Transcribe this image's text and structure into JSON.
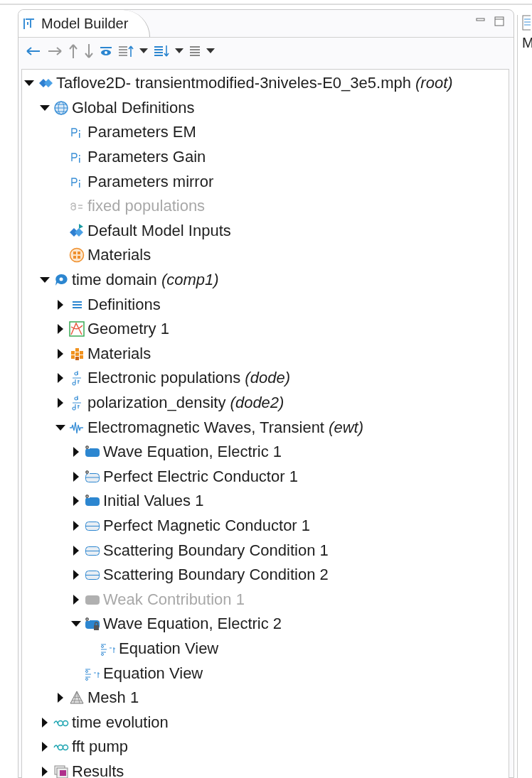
{
  "panel": {
    "title": "Model Builder",
    "side_text": "M"
  },
  "tree": [
    {
      "label": "Taflove2D- transientmodified-3niveles-E0_3e5.mph *(root)*",
      "kind": "model",
      "disabled": false,
      "expanded": true,
      "children": [
        {
          "label": "Global Definitions",
          "kind": "globe",
          "disabled": false,
          "expanded": true,
          "children": [
            {
              "label": "Parameters EM",
              "kind": "parameters",
              "disabled": false
            },
            {
              "label": "Parameters Gain",
              "kind": "parameters",
              "disabled": false
            },
            {
              "label": "Parameters mirror",
              "kind": "parameters",
              "disabled": false
            },
            {
              "label": "fixed populations",
              "kind": "variables",
              "disabled": true
            },
            {
              "label": "Default Model Inputs",
              "kind": "inputs",
              "disabled": false
            },
            {
              "label": "Materials",
              "kind": "materials-round",
              "disabled": false
            }
          ]
        },
        {
          "label": "time domain *(comp1)*",
          "kind": "component",
          "disabled": false,
          "expanded": true,
          "children": [
            {
              "label": "Definitions",
              "kind": "definitions",
              "disabled": false,
              "expanded": false
            },
            {
              "label": "Geometry 1",
              "kind": "geometry",
              "disabled": false,
              "expanded": false
            },
            {
              "label": "Materials",
              "kind": "materials",
              "disabled": false,
              "expanded": false
            },
            {
              "label": "Electronic populations *(dode)*",
              "kind": "ode",
              "disabled": false,
              "expanded": false
            },
            {
              "label": "polarization_density *(dode2)*",
              "kind": "ode",
              "disabled": false,
              "expanded": false
            },
            {
              "label": "Electromagnetic Waves, Transient *(ewt)*",
              "kind": "wave",
              "disabled": false,
              "expanded": true,
              "children": [
                {
                  "label": "Wave Equation, Electric 1",
                  "kind": "domain",
                  "disabled": false,
                  "expanded": false
                },
                {
                  "label": "Perfect Electric Conductor 1",
                  "kind": "boundary-default",
                  "disabled": false,
                  "expanded": false
                },
                {
                  "label": "Initial Values 1",
                  "kind": "domain",
                  "disabled": false,
                  "expanded": false
                },
                {
                  "label": "Perfect Magnetic Conductor 1",
                  "kind": "boundary",
                  "disabled": false,
                  "expanded": false
                },
                {
                  "label": "Scattering Boundary Condition 1",
                  "kind": "boundary",
                  "disabled": false,
                  "expanded": false
                },
                {
                  "label": "Scattering Boundary Condition 2",
                  "kind": "boundary",
                  "disabled": false,
                  "expanded": false
                },
                {
                  "label": "Weak Contribution 1",
                  "kind": "weak",
                  "disabled": true,
                  "expanded": false
                },
                {
                  "label": "Wave Equation, Electric 2",
                  "kind": "locked",
                  "disabled": false,
                  "expanded": true,
                  "children": [
                    {
                      "label": "Equation View",
                      "kind": "equation",
                      "disabled": false
                    }
                  ]
                },
                {
                  "label": "Equation View",
                  "kind": "equation",
                  "disabled": false
                }
              ]
            },
            {
              "label": "Mesh 1",
              "kind": "mesh",
              "disabled": false,
              "expanded": false
            }
          ]
        },
        {
          "label": "time evolution",
          "kind": "study",
          "disabled": false,
          "expanded": false
        },
        {
          "label": "fft pump",
          "kind": "study",
          "disabled": false,
          "expanded": false
        },
        {
          "label": "Results",
          "kind": "results",
          "disabled": false,
          "expanded": false
        }
      ]
    }
  ]
}
